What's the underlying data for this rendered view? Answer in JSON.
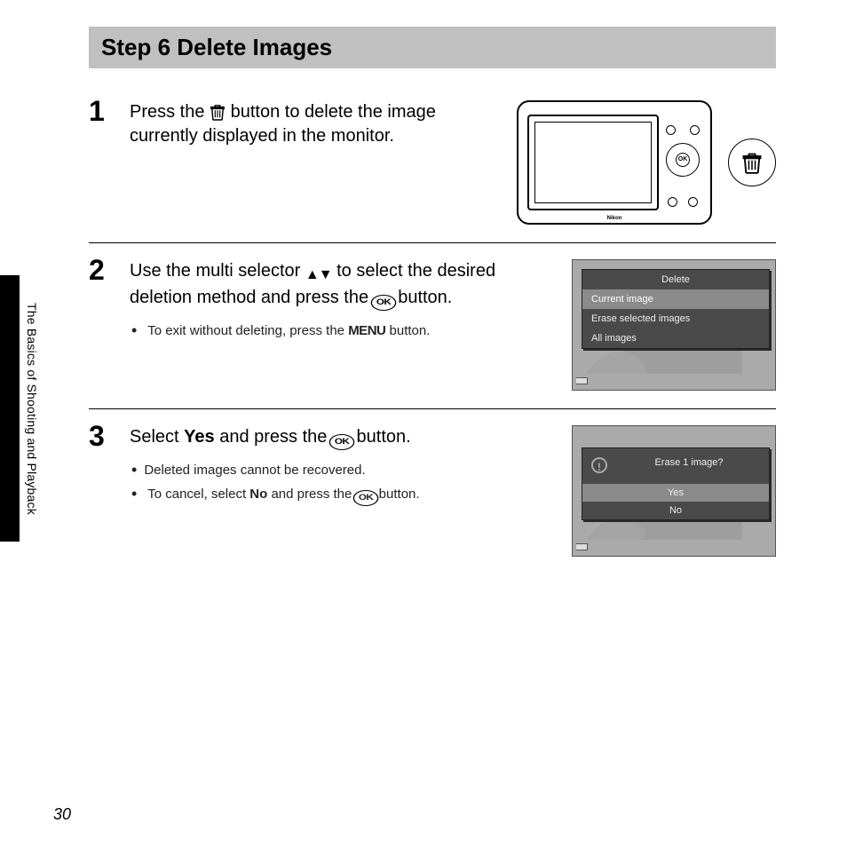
{
  "section_tab": "The Basics of Shooting and Playback",
  "page_number": "30",
  "title": "Step 6 Delete Images",
  "camera_brand": "Nikon",
  "steps": [
    {
      "num": "1",
      "main_before": "Press the ",
      "main_after": " button to delete the image currently displayed in the monitor."
    },
    {
      "num": "2",
      "main_before": "Use the multi selector ",
      "main_mid": " to select the desired deletion method and press the ",
      "main_after": " button.",
      "bullets": [
        {
          "before": "To exit without deleting, press the ",
          "after": " button."
        }
      ],
      "lcd": {
        "title": "Delete",
        "options": [
          "Current image",
          "Erase selected images",
          "All images"
        ],
        "selected_index": 0
      }
    },
    {
      "num": "3",
      "main_before": "Select ",
      "main_bold": "Yes",
      "main_mid": " and press the ",
      "main_after": " button.",
      "bullets": [
        {
          "text": "Deleted images cannot be recovered."
        },
        {
          "before": "To cancel, select ",
          "bold": "No",
          "mid": " and press the ",
          "after": " button."
        }
      ],
      "lcd": {
        "prompt": "Erase 1 image?",
        "options": [
          "Yes",
          "No"
        ],
        "selected_index": 0
      }
    }
  ]
}
